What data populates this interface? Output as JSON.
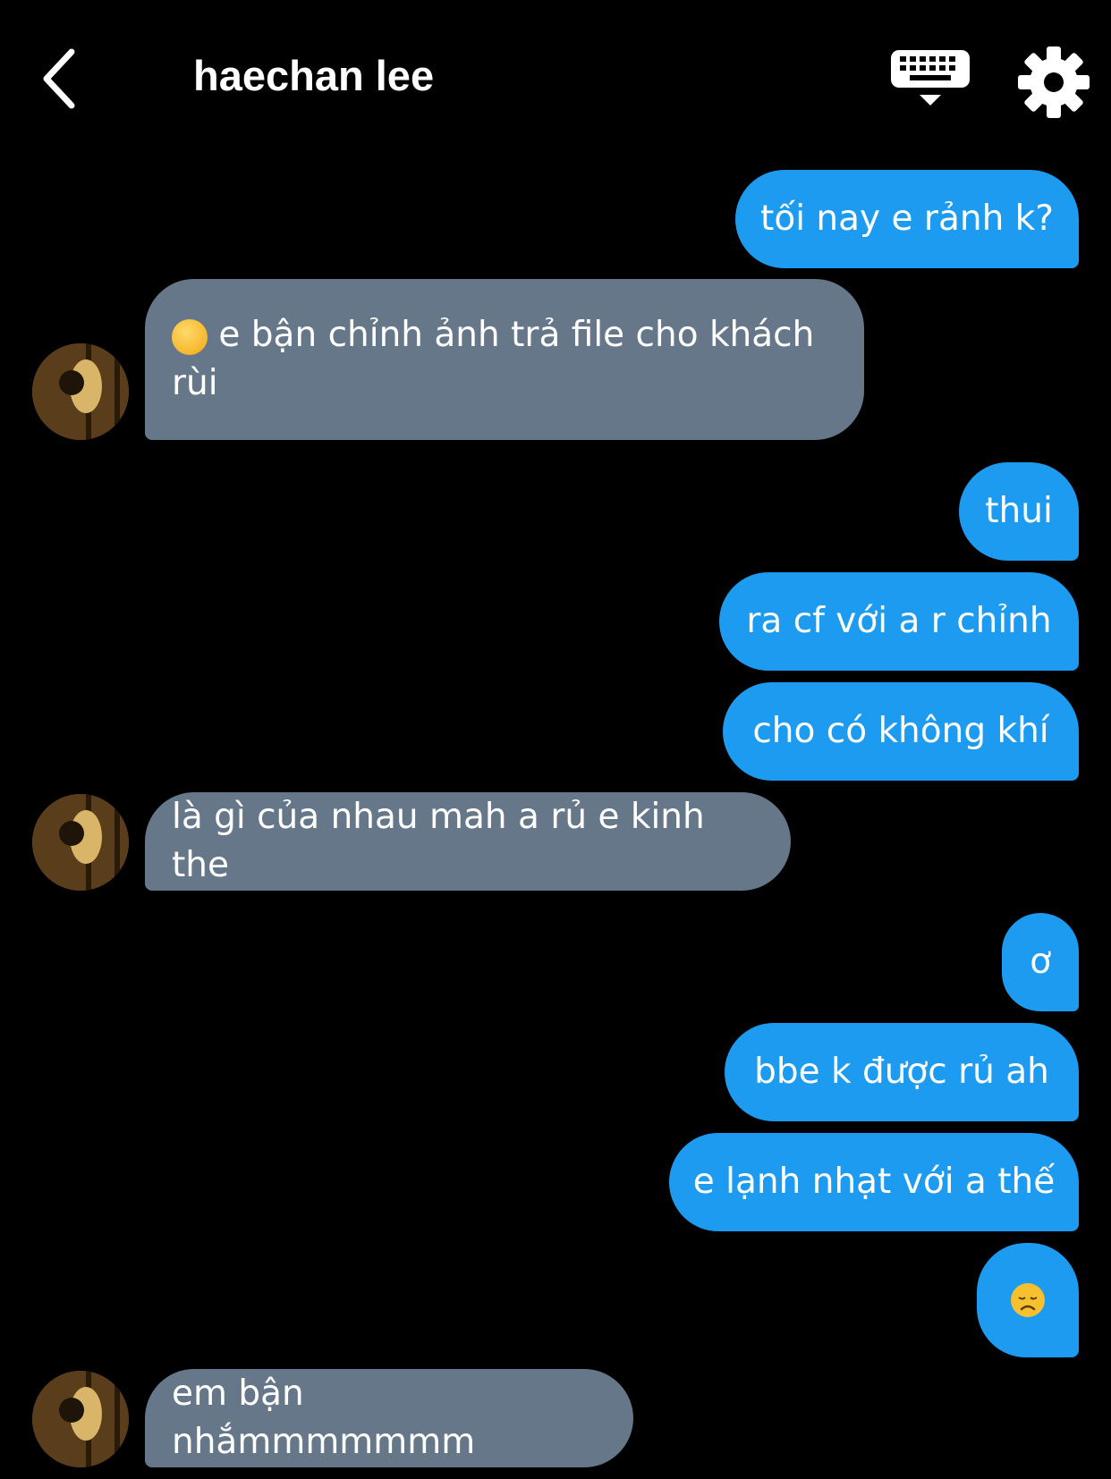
{
  "header": {
    "title": "haechan lee",
    "back_icon": "chevron-left-icon",
    "keyboard_icon": "keyboard-icon",
    "settings_icon": "gear-icon"
  },
  "colors": {
    "background": "#000000",
    "sent_bubble": "#1d9bf0",
    "received_bubble": "#66778a",
    "text": "#ffffff"
  },
  "messages": [
    {
      "side": "sent",
      "text": "tối nay e rảnh k?"
    },
    {
      "side": "received",
      "emoji": "pleading-face-emoji",
      "text": "e bận chỉnh ảnh trả file cho khách rùi"
    },
    {
      "side": "sent",
      "text": "thui"
    },
    {
      "side": "sent",
      "text": "ra cf với a r chỉnh"
    },
    {
      "side": "sent",
      "text": "cho có không khí"
    },
    {
      "side": "received",
      "text": "là gì của nhau mah a rủ e kinh the"
    },
    {
      "side": "sent",
      "text": "ơ"
    },
    {
      "side": "sent",
      "text": "bbe k được rủ ah"
    },
    {
      "side": "sent",
      "text": "e lạnh nhạt với a thế"
    },
    {
      "side": "sent",
      "emoji": "disappointed-face-emoji"
    },
    {
      "side": "received",
      "text": "em bận nhắmmmmmmm"
    }
  ]
}
